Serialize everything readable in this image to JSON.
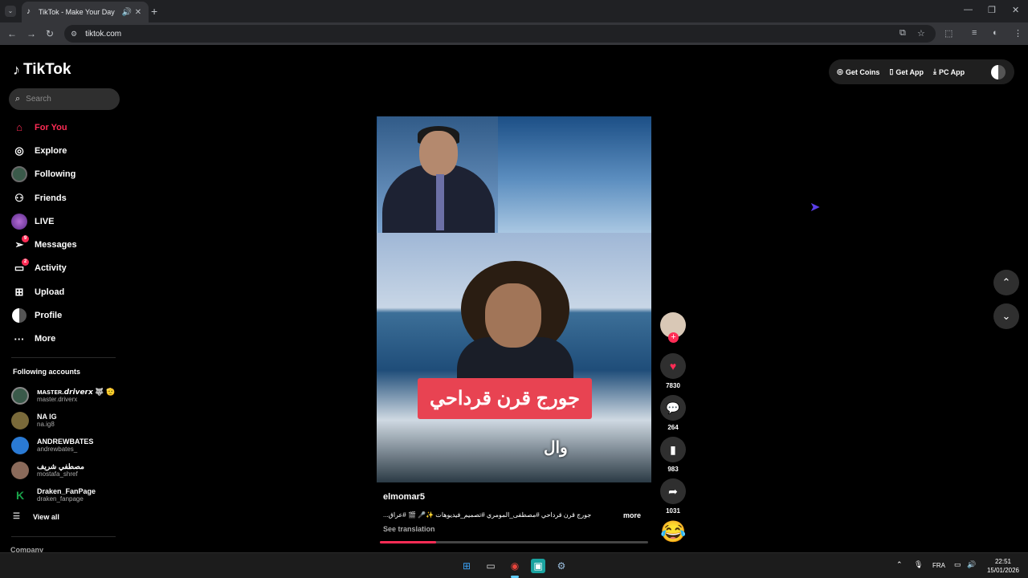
{
  "browser": {
    "tab_title": "TikTok - Make Your Day",
    "tab_audio_icon": "speaker-icon",
    "tab_close": "✕",
    "new_tab": "+",
    "url": "tiktok.com"
  },
  "sidebar": {
    "logo": "TikTok",
    "search_placeholder": "Search",
    "nav": [
      {
        "label": "For You",
        "icon": "home-icon",
        "active": true
      },
      {
        "label": "Explore",
        "icon": "compass-icon"
      },
      {
        "label": "Following",
        "icon": "following-avatar-icon"
      },
      {
        "label": "Friends",
        "icon": "friends-icon"
      },
      {
        "label": "LIVE",
        "icon": "live-icon"
      },
      {
        "label": "Messages",
        "icon": "messages-icon",
        "badge": "9"
      },
      {
        "label": "Activity",
        "icon": "activity-icon",
        "badge": "2"
      },
      {
        "label": "Upload",
        "icon": "upload-icon"
      },
      {
        "label": "Profile",
        "icon": "profile-icon"
      },
      {
        "label": "More",
        "icon": "more-icon"
      }
    ],
    "following_heading": "Following accounts",
    "following_accounts": [
      {
        "name": "ᴍᴀsᴛᴇʀ.𝙙𝙧𝙞𝙫𝙚𝙧𝙭 🐺 🫡",
        "handle": "master.driverx",
        "color": "#3a5a4a"
      },
      {
        "name": "NA IG",
        "handle": "na.ig8",
        "color": "#7a6a3a"
      },
      {
        "name": "ANDREWBATES",
        "handle": "andrewbates_",
        "color": "#2a7ad4"
      },
      {
        "name": "مصطفي شريف",
        "handle": "mostafa_shref",
        "color": "#8a6a5a"
      },
      {
        "name": "Draken_FanPage",
        "handle": "draken_fanpage",
        "color": "#1aa34a"
      }
    ],
    "view_all": "View all",
    "company": "Company"
  },
  "top_right": {
    "get_coins": "Get Coins",
    "get_app": "Get App",
    "pc_app": "PC App"
  },
  "video": {
    "caption_overlay": "جورج قرن قرداحي",
    "subtitle": "وال",
    "username": "elmomar5",
    "description": "جورج قرن قرداحي #مصطفى_المومري #تصميم_فيديوهات ✨🎤 🎬 #عراق...",
    "more": "more",
    "see_translation": "See translation",
    "progress": 0.21
  },
  "actions": {
    "likes": "7830",
    "comments": "264",
    "saves": "983",
    "shares": "1031",
    "follow_plus": "+"
  },
  "taskbar": {
    "lang": "FRA",
    "time": "22:51",
    "date": "15/01/2026"
  }
}
